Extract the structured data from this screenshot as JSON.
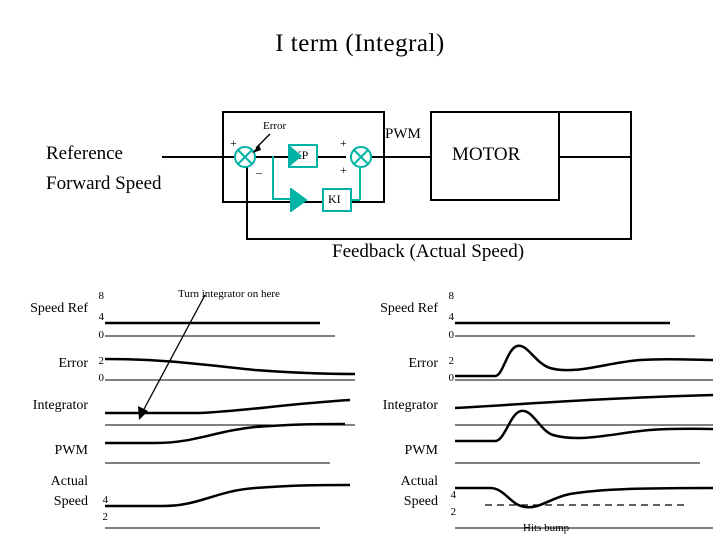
{
  "title": "I  term  (Integral)",
  "block_diagram": {
    "reference_label_line1": "Reference",
    "reference_label_line2": "Forward Speed",
    "error_label": "Error",
    "sum1_plus": "+",
    "sum1_minus": "_",
    "kp_label": "KP",
    "ki_label": "KI",
    "sum2_plus_top": "+",
    "sum2_plus_bottom": "+",
    "pwm_label": "PWM",
    "motor_label": "MOTOR",
    "feedback_label": "Feedback (Actual Speed)"
  },
  "left_chart": {
    "rows": [
      {
        "label": "Speed Ref",
        "ticks": [
          "8",
          "4",
          "0"
        ]
      },
      {
        "label": "Error",
        "ticks": [
          "2",
          "0"
        ]
      },
      {
        "label": "Integrator",
        "ticks": []
      },
      {
        "label": "PWM",
        "ticks": []
      },
      {
        "label_line1": "Actual",
        "label_line2": "Speed",
        "ticks": [
          "4",
          "2"
        ]
      }
    ],
    "annotation": "Turn integrator on here"
  },
  "right_chart": {
    "rows": [
      {
        "label": "Speed Ref",
        "ticks": [
          "8",
          "4",
          "0"
        ]
      },
      {
        "label": "Error",
        "ticks": [
          "2",
          "0"
        ]
      },
      {
        "label": "Integrator",
        "ticks": []
      },
      {
        "label": "PWM",
        "ticks": []
      },
      {
        "label_line1": "Actual",
        "label_line2": "Speed",
        "ticks": [
          "4",
          "2"
        ]
      }
    ],
    "annotation": "Hits bump"
  },
  "colors": {
    "teal": "#00b3a4",
    "black": "#000000",
    "background": "#ffffff"
  }
}
